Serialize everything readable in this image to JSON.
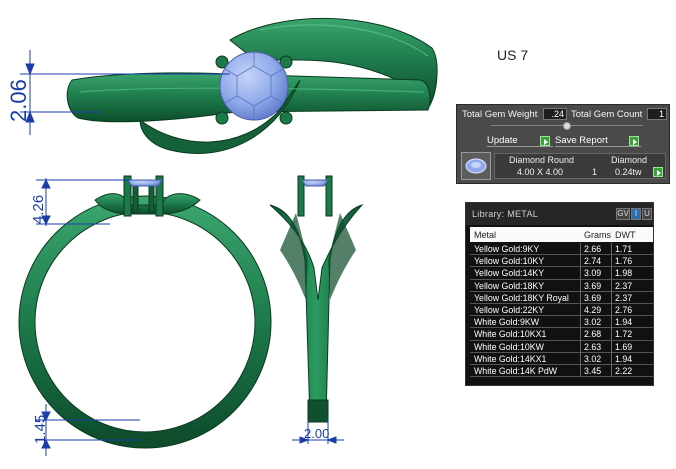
{
  "drawing": {
    "size_label": "US 7",
    "dimensions": {
      "top_height": "2.06",
      "head_height": "4.26",
      "shank_thickness": "1.45",
      "shank_width": "2.00"
    },
    "colors": {
      "metal": "#1f7a4c",
      "metal_dark": "#0c4a2a",
      "gem": "#8fa9ea",
      "dimension": "#1a3ea8"
    }
  },
  "gem_panel": {
    "total_weight_label": "Total Gem Weight",
    "total_weight_value": ".24",
    "total_count_label": "Total Gem Count",
    "total_count_value": "1",
    "update_label": "Update",
    "save_report_label": "Save Report",
    "gem": {
      "shape_header": "Diamond Round",
      "type_header": "Diamond",
      "size": "4.00 X 4.00",
      "count": "1",
      "weight": "0.24tw"
    }
  },
  "library": {
    "title": "Library: METAL",
    "icons": [
      "GV",
      "I",
      "U"
    ],
    "columns": [
      "Metal",
      "Grams",
      "DWT"
    ],
    "rows": [
      [
        "Yellow Gold:9KY",
        "2.66",
        "1.71"
      ],
      [
        "Yellow Gold:10KY",
        "2.74",
        "1.76"
      ],
      [
        "Yellow Gold:14KY",
        "3.09",
        "1.98"
      ],
      [
        "Yellow Gold:18KY",
        "3.69",
        "2.37"
      ],
      [
        "Yellow Gold:18KY Royal",
        "3.69",
        "2.37"
      ],
      [
        "Yellow Gold:22KY",
        "4.29",
        "2.76"
      ],
      [
        "White Gold:9KW",
        "3.02",
        "1.94"
      ],
      [
        "White Gold:10KX1",
        "2.68",
        "1.72"
      ],
      [
        "White Gold:10KW",
        "2.63",
        "1.69"
      ],
      [
        "White Gold:14KX1",
        "3.02",
        "1.94"
      ],
      [
        "White Gold:14K PdW",
        "3.45",
        "2.22"
      ]
    ]
  }
}
